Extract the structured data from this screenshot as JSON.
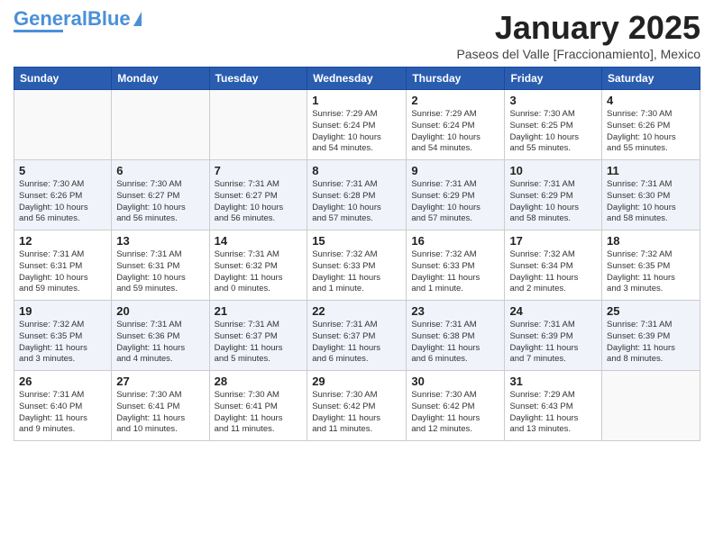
{
  "header": {
    "logo_general": "General",
    "logo_blue": "Blue",
    "month_title": "January 2025",
    "subtitle": "Paseos del Valle [Fraccionamiento], Mexico"
  },
  "weekdays": [
    "Sunday",
    "Monday",
    "Tuesday",
    "Wednesday",
    "Thursday",
    "Friday",
    "Saturday"
  ],
  "weeks": [
    [
      {
        "day": "",
        "info": ""
      },
      {
        "day": "",
        "info": ""
      },
      {
        "day": "",
        "info": ""
      },
      {
        "day": "1",
        "info": "Sunrise: 7:29 AM\nSunset: 6:24 PM\nDaylight: 10 hours\nand 54 minutes."
      },
      {
        "day": "2",
        "info": "Sunrise: 7:29 AM\nSunset: 6:24 PM\nDaylight: 10 hours\nand 54 minutes."
      },
      {
        "day": "3",
        "info": "Sunrise: 7:30 AM\nSunset: 6:25 PM\nDaylight: 10 hours\nand 55 minutes."
      },
      {
        "day": "4",
        "info": "Sunrise: 7:30 AM\nSunset: 6:26 PM\nDaylight: 10 hours\nand 55 minutes."
      }
    ],
    [
      {
        "day": "5",
        "info": "Sunrise: 7:30 AM\nSunset: 6:26 PM\nDaylight: 10 hours\nand 56 minutes."
      },
      {
        "day": "6",
        "info": "Sunrise: 7:30 AM\nSunset: 6:27 PM\nDaylight: 10 hours\nand 56 minutes."
      },
      {
        "day": "7",
        "info": "Sunrise: 7:31 AM\nSunset: 6:27 PM\nDaylight: 10 hours\nand 56 minutes."
      },
      {
        "day": "8",
        "info": "Sunrise: 7:31 AM\nSunset: 6:28 PM\nDaylight: 10 hours\nand 57 minutes."
      },
      {
        "day": "9",
        "info": "Sunrise: 7:31 AM\nSunset: 6:29 PM\nDaylight: 10 hours\nand 57 minutes."
      },
      {
        "day": "10",
        "info": "Sunrise: 7:31 AM\nSunset: 6:29 PM\nDaylight: 10 hours\nand 58 minutes."
      },
      {
        "day": "11",
        "info": "Sunrise: 7:31 AM\nSunset: 6:30 PM\nDaylight: 10 hours\nand 58 minutes."
      }
    ],
    [
      {
        "day": "12",
        "info": "Sunrise: 7:31 AM\nSunset: 6:31 PM\nDaylight: 10 hours\nand 59 minutes."
      },
      {
        "day": "13",
        "info": "Sunrise: 7:31 AM\nSunset: 6:31 PM\nDaylight: 10 hours\nand 59 minutes."
      },
      {
        "day": "14",
        "info": "Sunrise: 7:31 AM\nSunset: 6:32 PM\nDaylight: 11 hours\nand 0 minutes."
      },
      {
        "day": "15",
        "info": "Sunrise: 7:32 AM\nSunset: 6:33 PM\nDaylight: 11 hours\nand 1 minute."
      },
      {
        "day": "16",
        "info": "Sunrise: 7:32 AM\nSunset: 6:33 PM\nDaylight: 11 hours\nand 1 minute."
      },
      {
        "day": "17",
        "info": "Sunrise: 7:32 AM\nSunset: 6:34 PM\nDaylight: 11 hours\nand 2 minutes."
      },
      {
        "day": "18",
        "info": "Sunrise: 7:32 AM\nSunset: 6:35 PM\nDaylight: 11 hours\nand 3 minutes."
      }
    ],
    [
      {
        "day": "19",
        "info": "Sunrise: 7:32 AM\nSunset: 6:35 PM\nDaylight: 11 hours\nand 3 minutes."
      },
      {
        "day": "20",
        "info": "Sunrise: 7:31 AM\nSunset: 6:36 PM\nDaylight: 11 hours\nand 4 minutes."
      },
      {
        "day": "21",
        "info": "Sunrise: 7:31 AM\nSunset: 6:37 PM\nDaylight: 11 hours\nand 5 minutes."
      },
      {
        "day": "22",
        "info": "Sunrise: 7:31 AM\nSunset: 6:37 PM\nDaylight: 11 hours\nand 6 minutes."
      },
      {
        "day": "23",
        "info": "Sunrise: 7:31 AM\nSunset: 6:38 PM\nDaylight: 11 hours\nand 6 minutes."
      },
      {
        "day": "24",
        "info": "Sunrise: 7:31 AM\nSunset: 6:39 PM\nDaylight: 11 hours\nand 7 minutes."
      },
      {
        "day": "25",
        "info": "Sunrise: 7:31 AM\nSunset: 6:39 PM\nDaylight: 11 hours\nand 8 minutes."
      }
    ],
    [
      {
        "day": "26",
        "info": "Sunrise: 7:31 AM\nSunset: 6:40 PM\nDaylight: 11 hours\nand 9 minutes."
      },
      {
        "day": "27",
        "info": "Sunrise: 7:30 AM\nSunset: 6:41 PM\nDaylight: 11 hours\nand 10 minutes."
      },
      {
        "day": "28",
        "info": "Sunrise: 7:30 AM\nSunset: 6:41 PM\nDaylight: 11 hours\nand 11 minutes."
      },
      {
        "day": "29",
        "info": "Sunrise: 7:30 AM\nSunset: 6:42 PM\nDaylight: 11 hours\nand 11 minutes."
      },
      {
        "day": "30",
        "info": "Sunrise: 7:30 AM\nSunset: 6:42 PM\nDaylight: 11 hours\nand 12 minutes."
      },
      {
        "day": "31",
        "info": "Sunrise: 7:29 AM\nSunset: 6:43 PM\nDaylight: 11 hours\nand 13 minutes."
      },
      {
        "day": "",
        "info": ""
      }
    ]
  ]
}
